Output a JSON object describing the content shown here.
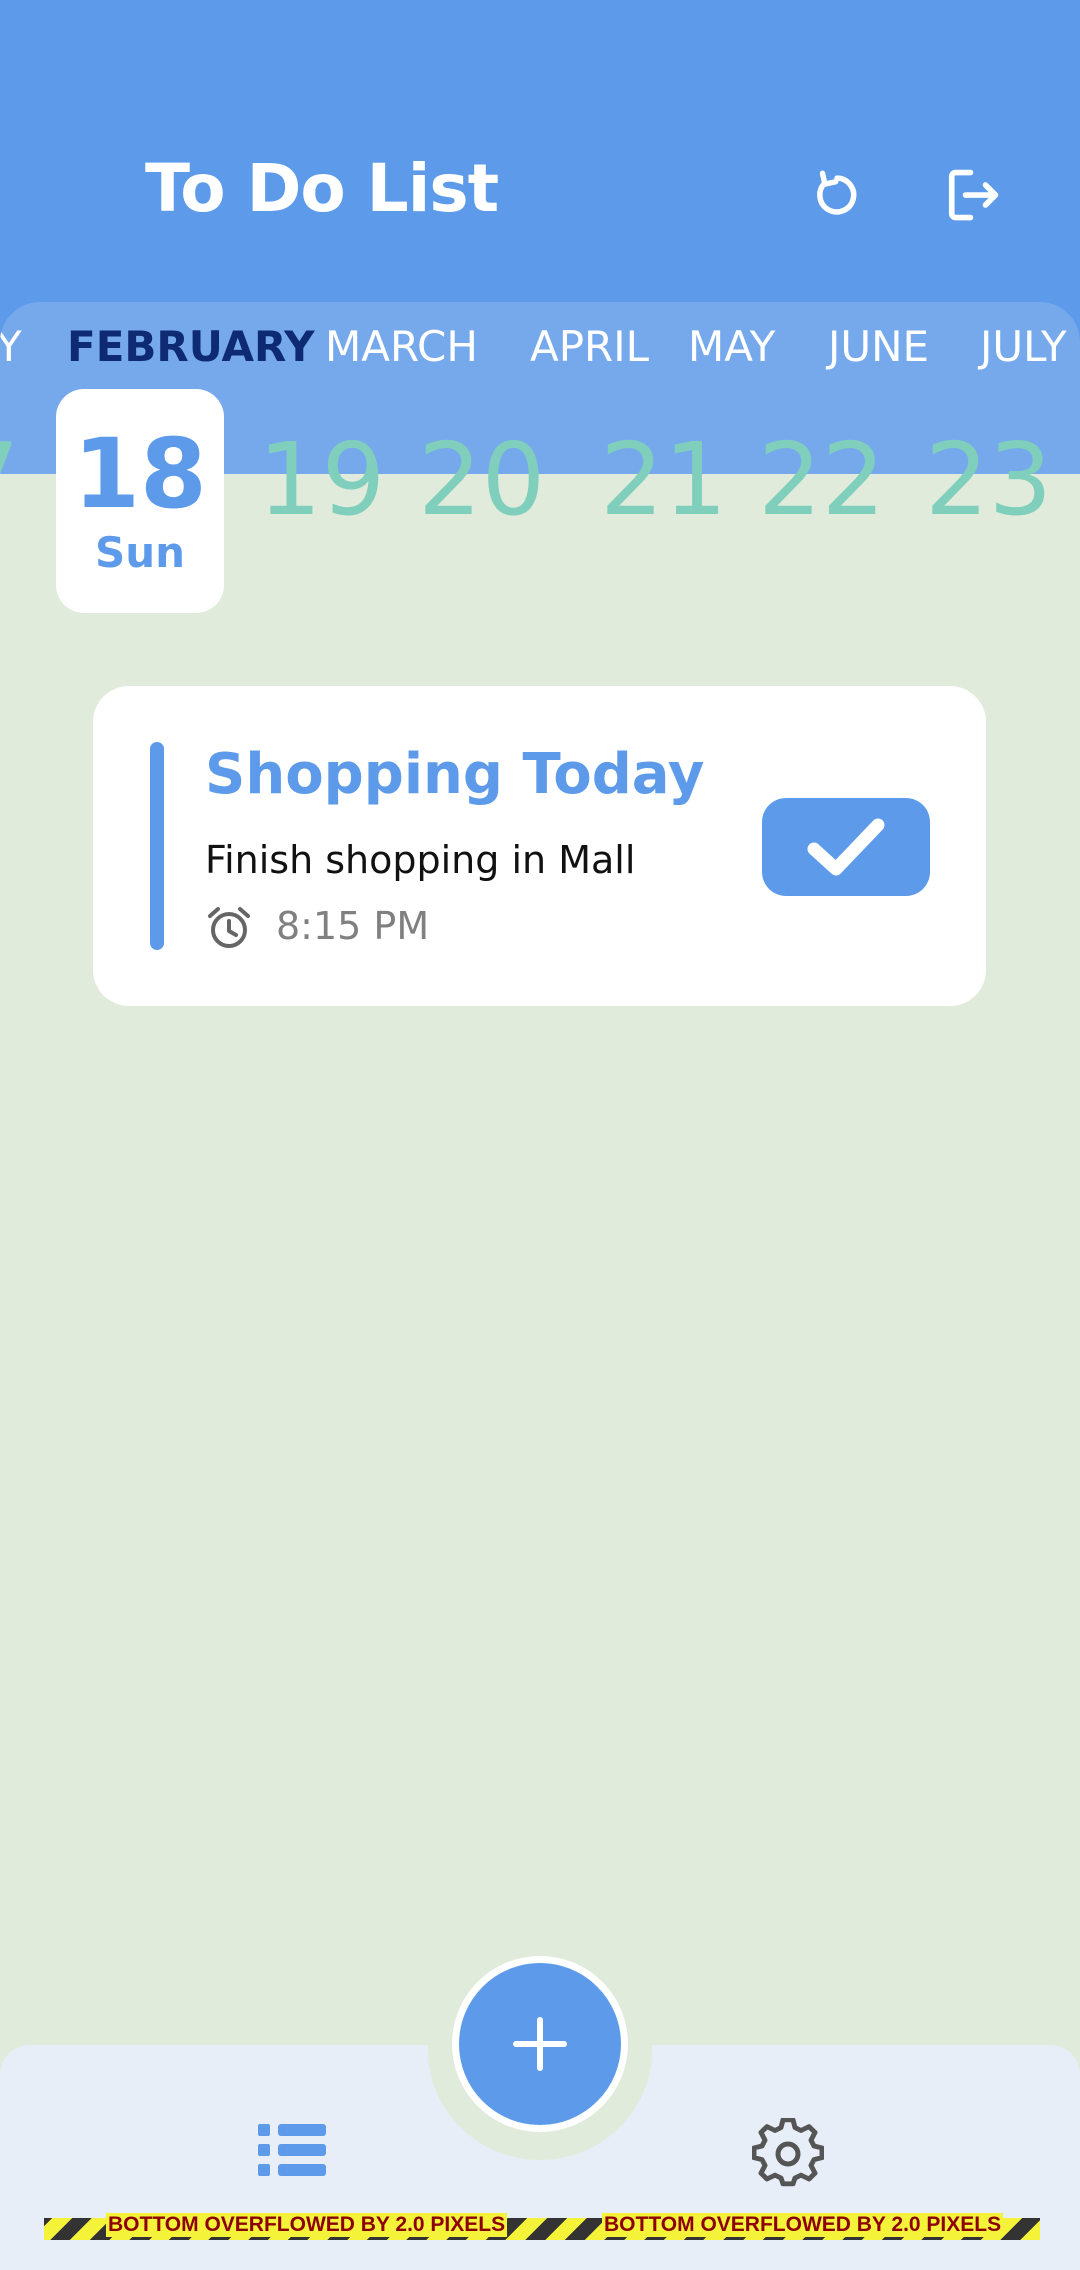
{
  "app": {
    "title": "To Do List"
  },
  "header": {
    "refresh_icon": "refresh-icon",
    "logout_icon": "logout-icon"
  },
  "months": [
    "Y",
    "FEBRUARY",
    "MARCH",
    "APRIL",
    "MAY",
    "JUNE",
    "JULY"
  ],
  "active_month": "FEBRUARY",
  "days": {
    "prev_partial": "7",
    "selected": {
      "number": "18",
      "weekday": "Sun"
    },
    "next": [
      "19",
      "20",
      "21",
      "22",
      "23"
    ]
  },
  "task": {
    "title": "Shopping Today",
    "description": "Finish shopping in Mall",
    "time": "8:15 PM",
    "completed": true
  },
  "bottom_nav": {
    "add_icon": "plus-icon",
    "list_icon": "list-icon",
    "settings_icon": "gear-icon"
  },
  "debug": {
    "overflow_message": "BOTTOM OVERFLOWED BY 2.0 PIXELS"
  },
  "colors": {
    "primary": "#5d9bea",
    "background": "#e0ebdc",
    "day_inactive": "#7fcfbc",
    "active_month": "#0e2a73"
  }
}
